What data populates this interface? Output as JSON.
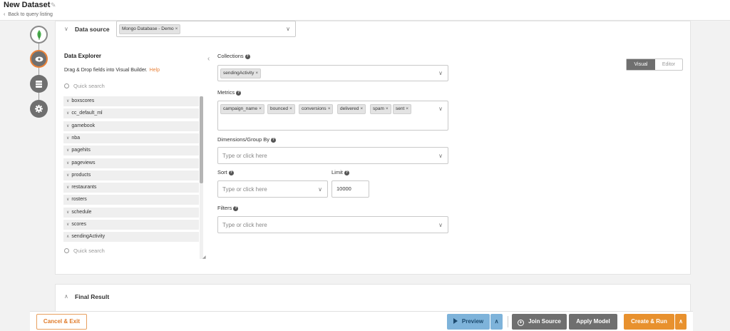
{
  "header": {
    "title": "New Dataset",
    "back_link": "Back to query listing"
  },
  "data_source": {
    "section_label": "Data source",
    "selected": "Mongo Database - Demo"
  },
  "explorer": {
    "title": "Data Explorer",
    "hint": "Drag & Drop fields into Visual Builder.",
    "help_link": "Help",
    "search_placeholder": "Quick search",
    "items": [
      "boxscores",
      "cc_default_ml",
      "gamebook",
      "nba",
      "pagehits",
      "pageviews",
      "products",
      "restaurants",
      "rosters",
      "schedule",
      "scores",
      "sendingActivity"
    ],
    "sub_search_placeholder": "Quick search"
  },
  "builder": {
    "collections_label": "Collections",
    "collections": [
      "sendingActivity"
    ],
    "metrics_label": "Metrics",
    "metrics": [
      "campaign_name",
      "bounced",
      "conversions",
      "delivered",
      "spam",
      "sent"
    ],
    "dimensions_label": "Dimensions/Group By",
    "dimensions_placeholder": "Type or click here",
    "sort_label": "Sort",
    "sort_placeholder": "Type or click here",
    "limit_label": "Limit",
    "limit_value": "10000",
    "filters_label": "Filters",
    "filters_placeholder": "Type or click here"
  },
  "mode_toggle": {
    "visual": "Visual",
    "editor": "Editor",
    "active": "Visual"
  },
  "final_result": {
    "label": "Final Result"
  },
  "footer": {
    "cancel": "Cancel & Exit",
    "preview": "Preview",
    "join_source": "Join Source",
    "apply_model": "Apply Model",
    "create_run": "Create & Run"
  },
  "colors": {
    "accent": "#e8912e",
    "preview": "#7eb3da",
    "neutral": "#6f6f6f"
  }
}
